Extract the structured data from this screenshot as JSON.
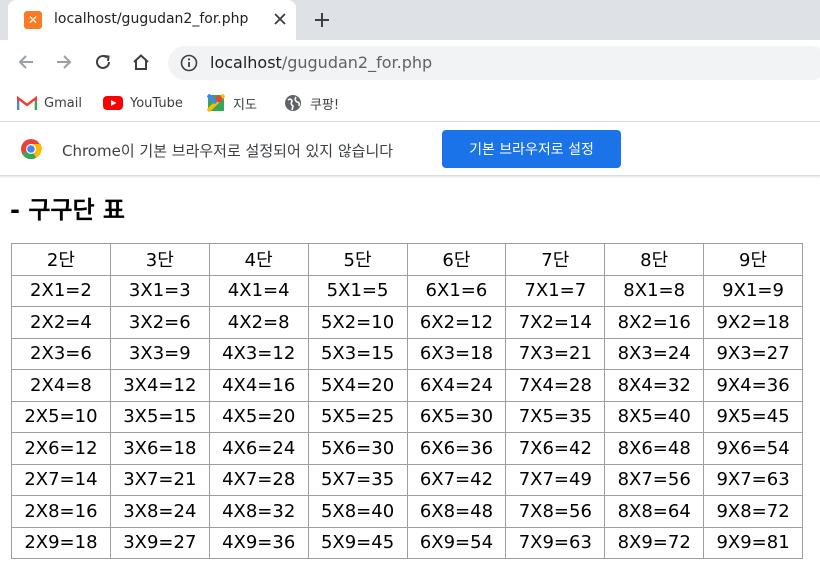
{
  "browser": {
    "tab": {
      "title": "localhost/gugudan2_for.php"
    },
    "address": {
      "host": "localhost",
      "path": "/gugudan2_for.php"
    },
    "bookmarks": [
      {
        "label": "Gmail",
        "icon": "gmail-icon"
      },
      {
        "label": "YouTube",
        "icon": "youtube-icon"
      },
      {
        "label": "지도",
        "icon": "maps-icon"
      },
      {
        "label": "쿠팡!",
        "icon": "globe-icon"
      }
    ],
    "infobar": {
      "message": "Chrome이 기본 브라우저로 설정되어 있지 않습니다",
      "button_label": "기본 브라우저로 설정"
    }
  },
  "page": {
    "title": "- 구구단 표",
    "headers": [
      "2단",
      "3단",
      "4단",
      "5단",
      "6단",
      "7단",
      "8단",
      "9단"
    ],
    "rows": [
      [
        "2X1=2",
        "3X1=3",
        "4X1=4",
        "5X1=5",
        "6X1=6",
        "7X1=7",
        "8X1=8",
        "9X1=9"
      ],
      [
        "2X2=4",
        "3X2=6",
        "4X2=8",
        "5X2=10",
        "6X2=12",
        "7X2=14",
        "8X2=16",
        "9X2=18"
      ],
      [
        "2X3=6",
        "3X3=9",
        "4X3=12",
        "5X3=15",
        "6X3=18",
        "7X3=21",
        "8X3=24",
        "9X3=27"
      ],
      [
        "2X4=8",
        "3X4=12",
        "4X4=16",
        "5X4=20",
        "6X4=24",
        "7X4=28",
        "8X4=32",
        "9X4=36"
      ],
      [
        "2X5=10",
        "3X5=15",
        "4X5=20",
        "5X5=25",
        "6X5=30",
        "7X5=35",
        "8X5=40",
        "9X5=45"
      ],
      [
        "2X6=12",
        "3X6=18",
        "4X6=24",
        "5X6=30",
        "6X6=36",
        "7X6=42",
        "8X6=48",
        "9X6=54"
      ],
      [
        "2X7=14",
        "3X7=21",
        "4X7=28",
        "5X7=35",
        "6X7=42",
        "7X7=49",
        "8X7=56",
        "9X7=63"
      ],
      [
        "2X8=16",
        "3X8=24",
        "4X8=32",
        "5X8=40",
        "6X8=48",
        "7X8=56",
        "8X8=64",
        "9X8=72"
      ],
      [
        "2X9=18",
        "3X9=27",
        "4X9=36",
        "5X9=45",
        "6X9=54",
        "7X9=63",
        "8X9=72",
        "9X9=81"
      ]
    ]
  },
  "colors": {
    "tabstrip_bg": "#dee1e6",
    "omnibox_bg": "#f1f3f4",
    "accent_button": "#1a73e8",
    "favicon": "#fb7a24",
    "table_border": "#9e9e9e"
  }
}
